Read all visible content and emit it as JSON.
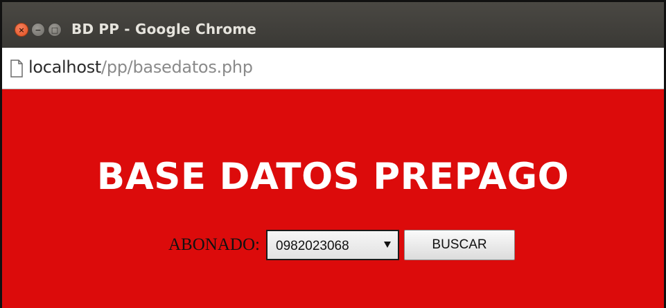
{
  "window": {
    "title": "BD PP - Google Chrome",
    "controls": {
      "close_glyph": "×",
      "minimize_glyph": "−",
      "maximize_glyph": "□"
    }
  },
  "address_bar": {
    "host": "localhost",
    "path": "/pp/basedatos.php",
    "icon": "page-icon"
  },
  "page": {
    "background_color": "#dc0b0b",
    "heading": "BASE DATOS PREPAGO",
    "form": {
      "label": "ABONADO:",
      "select_value": "0982023068",
      "button_label": "BUSCAR"
    }
  }
}
